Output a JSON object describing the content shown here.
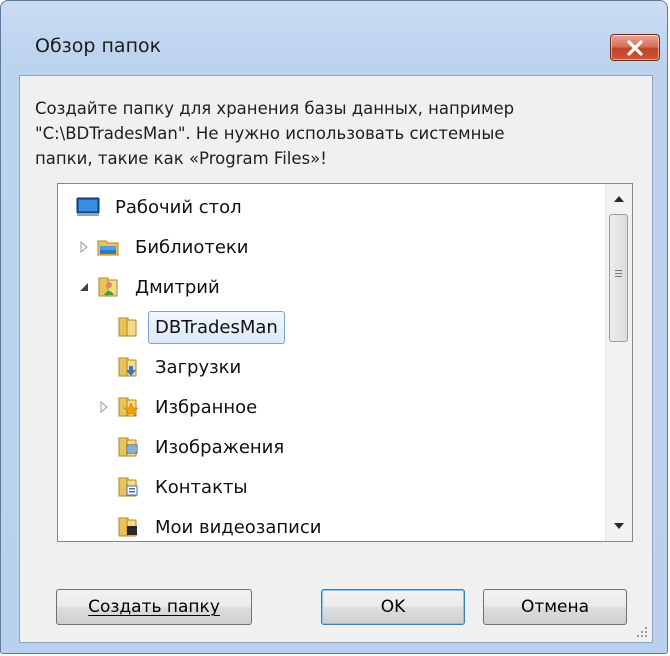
{
  "window": {
    "title": "Обзор папок"
  },
  "prompt": {
    "line1": "Создайте папку для хранения базы данных, например",
    "line2": "\"C:\\BDTradesMan\". Не нужно использовать системные",
    "line3": "папки, такие как «Program Files»!"
  },
  "tree": {
    "items": [
      {
        "label": "Рабочий стол",
        "icon": "desktop-icon"
      },
      {
        "label": "Библиотеки",
        "icon": "libraries-icon",
        "expander": "collapsed"
      },
      {
        "label": "Дмитрий",
        "icon": "user-folder-icon",
        "expander": "expanded"
      },
      {
        "label": "DBTradesMan",
        "icon": "folder-icon",
        "selected": true
      },
      {
        "label": "Загрузки",
        "icon": "downloads-folder-icon"
      },
      {
        "label": "Избранное",
        "icon": "favorites-folder-icon",
        "expander": "collapsed"
      },
      {
        "label": "Изображения",
        "icon": "pictures-folder-icon"
      },
      {
        "label": "Контакты",
        "icon": "contacts-folder-icon"
      },
      {
        "label": "Мои видеозаписи",
        "icon": "videos-folder-icon"
      }
    ]
  },
  "buttons": {
    "new_folder": "Создать папку",
    "ok": "OK",
    "cancel": "Отмена"
  },
  "colors": {
    "title_bar": "#bcd3ee",
    "close_red": "#c7442b",
    "selection_border": "#7da2ce",
    "folder_yellow": "#e8c25a"
  }
}
